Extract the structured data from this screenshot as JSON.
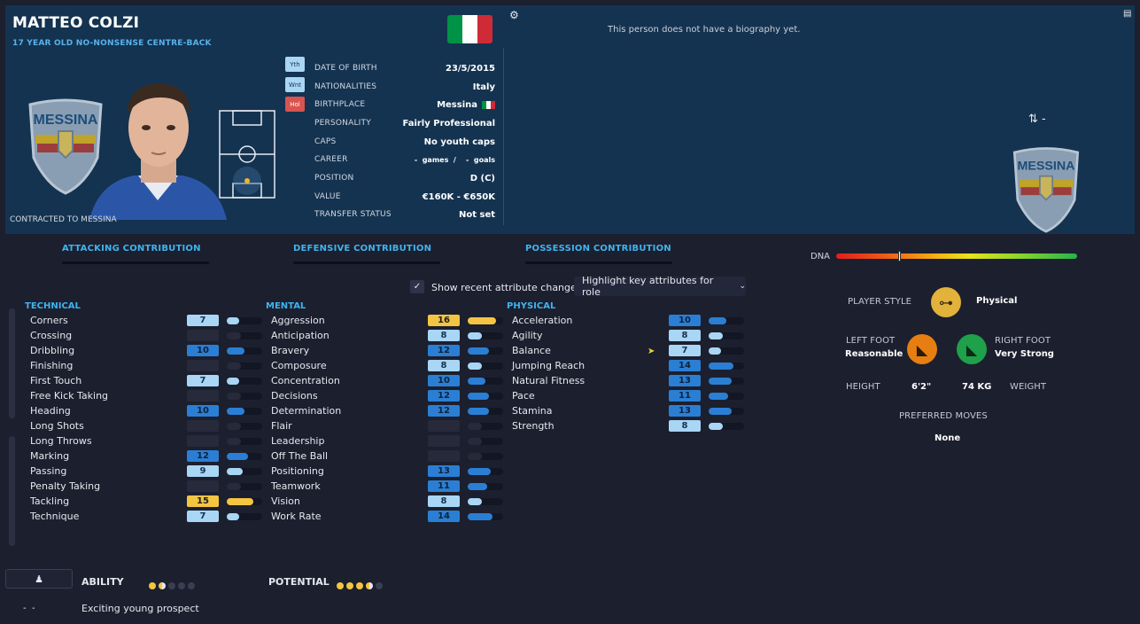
{
  "player": {
    "name": "MATTEO COLZI",
    "subtitle": "17 YEAR OLD NO-NONSENSE CENTRE-BACK",
    "contracted": "CONTRACTED TO MESSINA",
    "club_crest_text": "MESSINA",
    "biography": "This person does not have a biography yet.",
    "swap_value": "-"
  },
  "flag_colors": [
    "#009246",
    "#ffffff",
    "#ce2b37"
  ],
  "tags": [
    {
      "label": "Yth",
      "color": "#a9d6f5"
    },
    {
      "label": "Wnt",
      "color": "#a9d6f5"
    },
    {
      "label": "Hol",
      "color": "#d9534f"
    }
  ],
  "info": [
    {
      "label": "DATE OF BIRTH",
      "value": "23/5/2015"
    },
    {
      "label": "NATIONALITIES",
      "value": "Italy"
    },
    {
      "label": "BIRTHPLACE",
      "value": "Messina"
    },
    {
      "label": "PERSONALITY",
      "value": "Fairly Professional"
    },
    {
      "label": "CAPS",
      "value": "No youth caps"
    },
    {
      "label": "CAREER",
      "value": "-  games  /    -  goals"
    },
    {
      "label": "POSITION",
      "value": "D (C)"
    },
    {
      "label": "VALUE",
      "value": "€160K - €650K"
    },
    {
      "label": "TRANSFER STATUS",
      "value": "Not set"
    }
  ],
  "contributions": [
    "ATTACKING CONTRIBUTION",
    "DEFENSIVE CONTRIBUTION",
    "POSSESSION CONTRIBUTION"
  ],
  "dna": {
    "label": "DNA",
    "level": 0.26
  },
  "controls": {
    "show_changes_label": "Show recent attribute changes",
    "show_changes_checked": true,
    "highlight_label": "Highlight key attributes for role"
  },
  "attribute_groups": [
    {
      "title": "TECHNICAL",
      "items": [
        {
          "name": "Corners",
          "value": 7
        },
        {
          "name": "Crossing",
          "value": ""
        },
        {
          "name": "Dribbling",
          "value": 10
        },
        {
          "name": "Finishing",
          "value": ""
        },
        {
          "name": "First Touch",
          "value": 7
        },
        {
          "name": "Free Kick Taking",
          "value": ""
        },
        {
          "name": "Heading",
          "value": 10
        },
        {
          "name": "Long Shots",
          "value": ""
        },
        {
          "name": "Long Throws",
          "value": ""
        },
        {
          "name": "Marking",
          "value": 12
        },
        {
          "name": "Passing",
          "value": 9
        },
        {
          "name": "Penalty Taking",
          "value": ""
        },
        {
          "name": "Tackling",
          "value": 15
        },
        {
          "name": "Technique",
          "value": 7
        }
      ]
    },
    {
      "title": "MENTAL",
      "items": [
        {
          "name": "Aggression",
          "value": 16
        },
        {
          "name": "Anticipation",
          "value": 8
        },
        {
          "name": "Bravery",
          "value": 12
        },
        {
          "name": "Composure",
          "value": 8
        },
        {
          "name": "Concentration",
          "value": 10
        },
        {
          "name": "Decisions",
          "value": 12
        },
        {
          "name": "Determination",
          "value": 12
        },
        {
          "name": "Flair",
          "value": ""
        },
        {
          "name": "Leadership",
          "value": ""
        },
        {
          "name": "Off The Ball",
          "value": ""
        },
        {
          "name": "Positioning",
          "value": 13
        },
        {
          "name": "Teamwork",
          "value": 11
        },
        {
          "name": "Vision",
          "value": 8
        },
        {
          "name": "Work Rate",
          "value": 14
        }
      ]
    },
    {
      "title": "PHYSICAL",
      "items": [
        {
          "name": "Acceleration",
          "value": 10
        },
        {
          "name": "Agility",
          "value": 8
        },
        {
          "name": "Balance",
          "value": 7
        },
        {
          "name": "Jumping Reach",
          "value": 14
        },
        {
          "name": "Natural Fitness",
          "value": 13
        },
        {
          "name": "Pace",
          "value": 11
        },
        {
          "name": "Stamina",
          "value": 13
        },
        {
          "name": "Strength",
          "value": 8
        }
      ]
    }
  ],
  "style": {
    "player_style_label": "PLAYER STYLE",
    "player_style_value": "Physical",
    "left_foot_label": "LEFT FOOT",
    "left_foot_value": "Reasonable",
    "right_foot_label": "RIGHT FOOT",
    "right_foot_value": "Very Strong",
    "height_label": "HEIGHT",
    "height_value": "6'2\"",
    "weight_value": "74 KG",
    "weight_label": "WEIGHT",
    "preferred_moves_label": "PREFERRED MOVES",
    "preferred_moves_value": "None"
  },
  "bottom": {
    "ability_label": "ABILITY",
    "ability_stars": 1.5,
    "potential_label": "POTENTIAL",
    "potential_stars": 3.5,
    "scout_dash": "-  -",
    "scout_text": "Exciting young prospect"
  }
}
